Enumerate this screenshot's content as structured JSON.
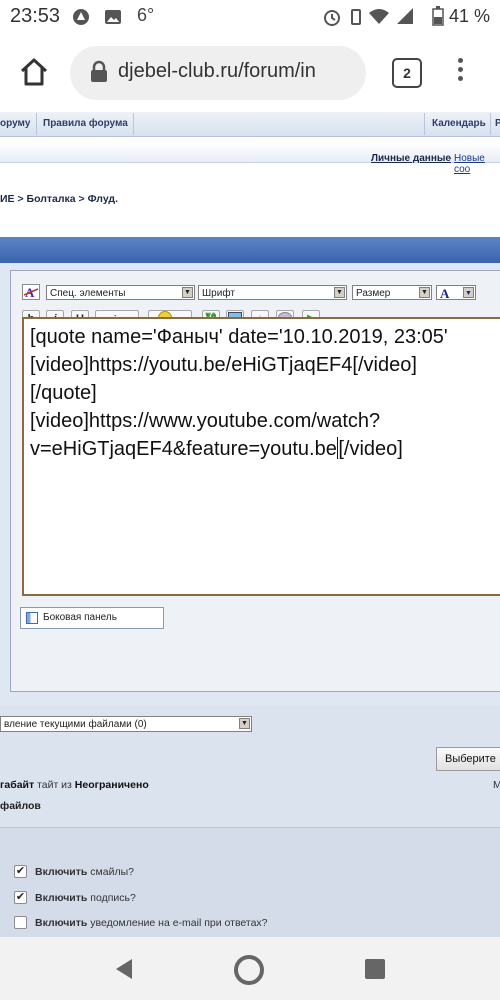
{
  "status": {
    "time": "23:53",
    "temp": "6°",
    "battery": "41 %"
  },
  "browser": {
    "url": "djebel-club.ru/forum/in",
    "tab_count": "2"
  },
  "forum_nav": {
    "item1": "ору му",
    "item1_text": "ормуму",
    "rules": "Правила форума",
    "calendar": "Календарь",
    "cut": "Р"
  },
  "nav_left": "орумy",
  "user_links": {
    "personal": "Личные данные",
    "dot": "·",
    "new": "Новые соо"
  },
  "breadcrumb": "ИЕ > Болталка > Флуд.",
  "editor": {
    "special": "Спец. элементы",
    "font": "Шрифт",
    "size": "Размер",
    "color_label": "A",
    "text_lines": [
      "[quote name='Фаныч' date='10.10.2019, 23:05'",
      "[video]https://youtu.be/eHiGTjaqEF4[/video]",
      "[/quote]",
      "[video]https://www.youtube.com/watch?",
      "v=eHiGTjaqEF4&feature=youtu.be"
    ],
    "text_tail": "[/video]",
    "side_panel": "Боковая панель"
  },
  "attachments": {
    "manage": "вление текущими файлами (0)",
    "choose": "Выберите",
    "size_prefix": "тайт из ",
    "size_value": "Неограничено",
    "size_bold_start": "габайт",
    "m": "М",
    "files": "файлов"
  },
  "options": [
    {
      "bold": "Включить",
      "rest": " смайлы?",
      "checked": true
    },
    {
      "bold": "Включить",
      "rest": " подпись?",
      "checked": true
    },
    {
      "bold": "Включить",
      "rest": " уведомление на e-mail при ответах?",
      "checked": false
    }
  ]
}
